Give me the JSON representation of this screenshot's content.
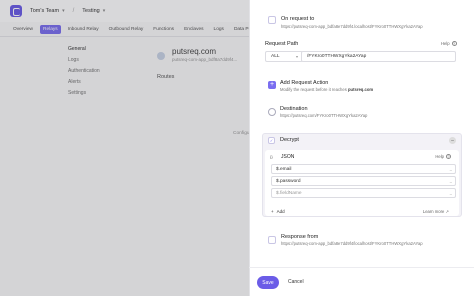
{
  "topbar": {
    "team": "Tom's Team",
    "project": "Testing"
  },
  "tabs": [
    "Overview",
    "Relays",
    "Inbound Relay",
    "Outbound Relay",
    "Functions",
    "Enclaves",
    "Logs",
    "Data Policies",
    "Fore"
  ],
  "sidenav": [
    "General",
    "Logs",
    "Authentication",
    "Alerts",
    "Settings"
  ],
  "connection": {
    "title": "putsreq.com",
    "subtitle": "putsreq-com-app_bdf8a7dd9f4..."
  },
  "main": {
    "routes": "Routes",
    "configure": "Configu"
  },
  "panel": {
    "on_request": {
      "title": "On request to",
      "url": "https://putsreq-com-app_bdfa8e7dd9f4.localhost/FYKro0TTHWXgYka2AYap"
    },
    "request_path": {
      "label": "Request Path",
      "help": "Help",
      "method": "ALL",
      "path": "/FYKro0TTHWXgYka2AYap"
    },
    "add_action": {
      "title": "Add Request Action",
      "desc_prefix": "Modify the request before it reaches",
      "desc_target": "putsreq.com"
    },
    "destination": {
      "title": "Destination",
      "url": "https://putsreq.com/FYKro0TTHWXgYka2AYap"
    },
    "decrypt": {
      "title": "Decrypt",
      "format": "JSON",
      "help": "Help",
      "fields": [
        "$.email",
        "$.password",
        "$.fieldName"
      ],
      "add": "Add",
      "learn_more": "Learn more"
    },
    "response": {
      "title": "Response from",
      "url": "https://putsreq-com-app_bdfa8e7dd9f4/localhost/FYKro0TTHWXgYka2AYap"
    },
    "footer": {
      "save": "Save",
      "cancel": "Cancel"
    }
  }
}
